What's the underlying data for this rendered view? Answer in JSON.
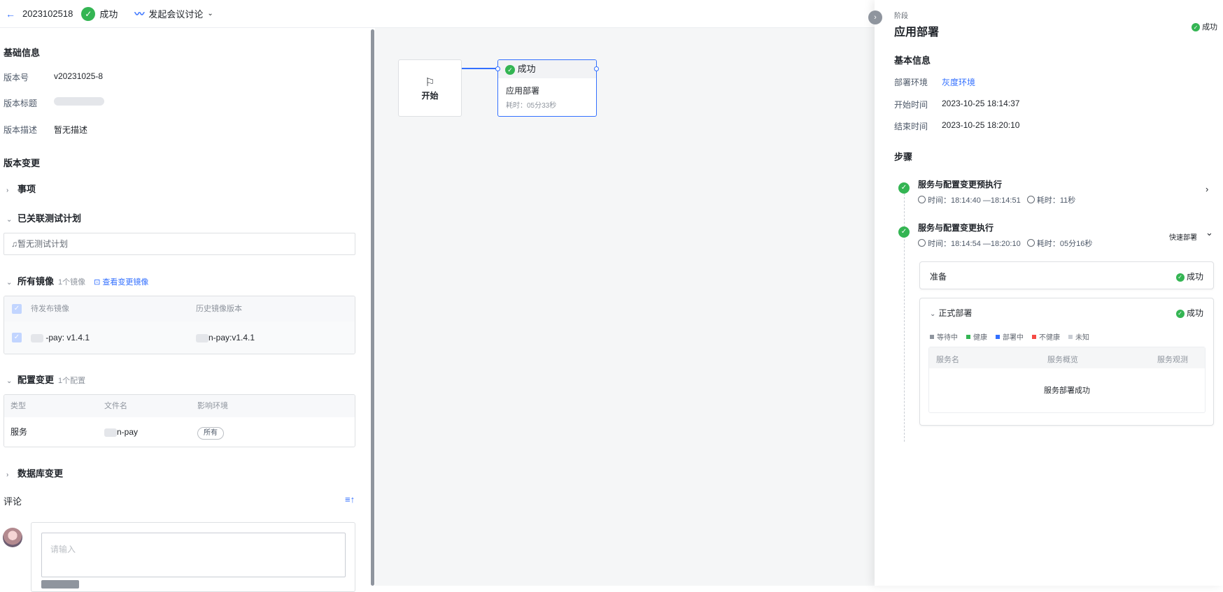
{
  "header": {
    "version_id": "2023102518",
    "status": "成功",
    "meeting_label": "发起会议讨论"
  },
  "basic": {
    "title": "基础信息",
    "version_no_label": "版本号",
    "version_no": "v20231025-8",
    "version_title_label": "版本标题",
    "version_desc_label": "版本描述",
    "version_desc": "暂无描述"
  },
  "changes": {
    "title": "版本变更",
    "items_label": "事项",
    "test_plan_label": "已关联测试计划",
    "test_plan_empty": "暂无测试计划",
    "images_label": "所有镜像",
    "images_count": "1个镜像",
    "images_link": "查看变更镜像",
    "images_headers": [
      "待发布镜像",
      "历史镜像版本"
    ],
    "images_rows": [
      {
        "pending": "-pay:  v1.4.1",
        "history": "n-pay:v1.4.1"
      }
    ],
    "config_label": "配置变更",
    "config_count": "1个配置",
    "config_headers": [
      "类型",
      "文件名",
      "影响环境"
    ],
    "config_rows": [
      {
        "type": "服务",
        "file": "n-pay",
        "env": "所有"
      }
    ],
    "db_label": "数据库变更"
  },
  "comment": {
    "title": "评论",
    "placeholder": "请输入"
  },
  "canvas": {
    "start_label": "开始",
    "deploy_status": "成功",
    "deploy_name": "应用部署",
    "deploy_duration": "耗时：05分33秒"
  },
  "drawer": {
    "stage_label": "阶段",
    "stage_title": "应用部署",
    "stage_status": "成功",
    "basic_title": "基本信息",
    "env_label": "部署环境",
    "env_value": "灰度环境",
    "start_label": "开始时间",
    "start_value": "2023-10-25 18:14:37",
    "end_label": "结束时间",
    "end_value": "2023-10-25 18:20:10",
    "steps_title": "步骤",
    "steps": [
      {
        "name": "服务与配置变更预执行",
        "time": "时间：18:14:40 —18:14:51",
        "cost": "耗时：11秒"
      },
      {
        "name": "服务与配置变更执行",
        "time": "时间：18:14:54 —18:20:10",
        "cost": "耗时：05分16秒"
      }
    ],
    "quick_deploy": "快速部署",
    "prepare_label": "准备",
    "prepare_status": "成功",
    "formal_label": "正式部署",
    "formal_status": "成功",
    "legend": [
      {
        "label": "等待中",
        "color": "#8f959e"
      },
      {
        "label": "健康",
        "color": "#34b553"
      },
      {
        "label": "部署中",
        "color": "#3370ff"
      },
      {
        "label": "不健康",
        "color": "#f54a45"
      },
      {
        "label": "未知",
        "color": "#c9cdd4"
      }
    ],
    "svc_headers": [
      "服务名",
      "服务概览",
      "服务观测"
    ],
    "svc_empty": "服务部署成功"
  }
}
